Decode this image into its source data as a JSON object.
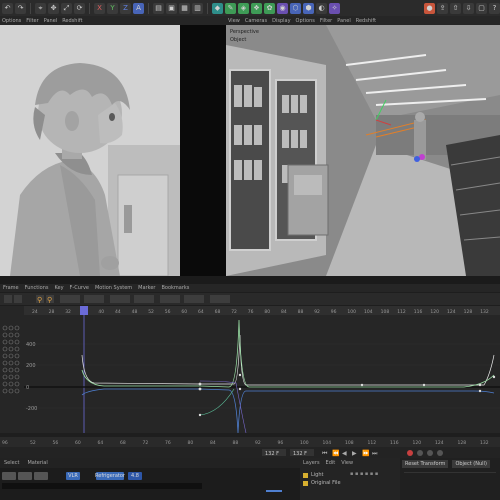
{
  "top_menu_left": [
    "Options",
    "Filter",
    "Panel",
    "Redshift"
  ],
  "top_menu_right": [
    "View",
    "Cameras",
    "Display",
    "Options",
    "Filter",
    "Panel",
    "Redshift"
  ],
  "viewport_right": {
    "label": "Perspective",
    "sublabel": "Object"
  },
  "timeline_menu": [
    "Frame",
    "Functions",
    "Key",
    "F-Curve",
    "Motion System",
    "Marker",
    "Bookmarks"
  ],
  "ruler_top": [
    "24",
    "28",
    "32",
    "36",
    "40",
    "44",
    "48",
    "52",
    "56",
    "60",
    "64",
    "68",
    "72",
    "76",
    "80",
    "84",
    "88",
    "92",
    "96",
    "100",
    "104",
    "108",
    "112",
    "116",
    "120",
    "124",
    "128",
    "132"
  ],
  "graph_y_labels": [
    "400",
    "200",
    "0",
    "-200"
  ],
  "frame_marker": "32",
  "bottom_ruler": [
    "52",
    "56",
    "60",
    "64",
    "68",
    "72",
    "76",
    "80",
    "84",
    "88",
    "92",
    "96",
    "100",
    "104",
    "108",
    "112",
    "116",
    "120",
    "124",
    "128",
    "132"
  ],
  "bottom_ruler_left": "96",
  "transport": {
    "current_frame": "132 F",
    "end_frame": "132 F"
  },
  "attrs_tabs": [
    "Select",
    "Material"
  ],
  "material_tags": [
    {
      "label": "VLR",
      "color": "#3a6ab8"
    },
    {
      "label": "Refrigerator",
      "color": "#3a6ab8"
    },
    {
      "label": "4.8",
      "color": "#2d56a8"
    }
  ],
  "layers_panel": {
    "tabs": [
      "Layers",
      "Edit",
      "View"
    ],
    "items": [
      "Light",
      "Original File"
    ]
  },
  "props_panel": {
    "tabs": [
      "Reset Transform",
      "Object (Null)"
    ]
  },
  "colors": {
    "curve_green": "#9be0a6",
    "curve_blue": "#4f7fd0",
    "curve_white": "#e8e8e8",
    "marker_blue": "#6b6bd8"
  }
}
